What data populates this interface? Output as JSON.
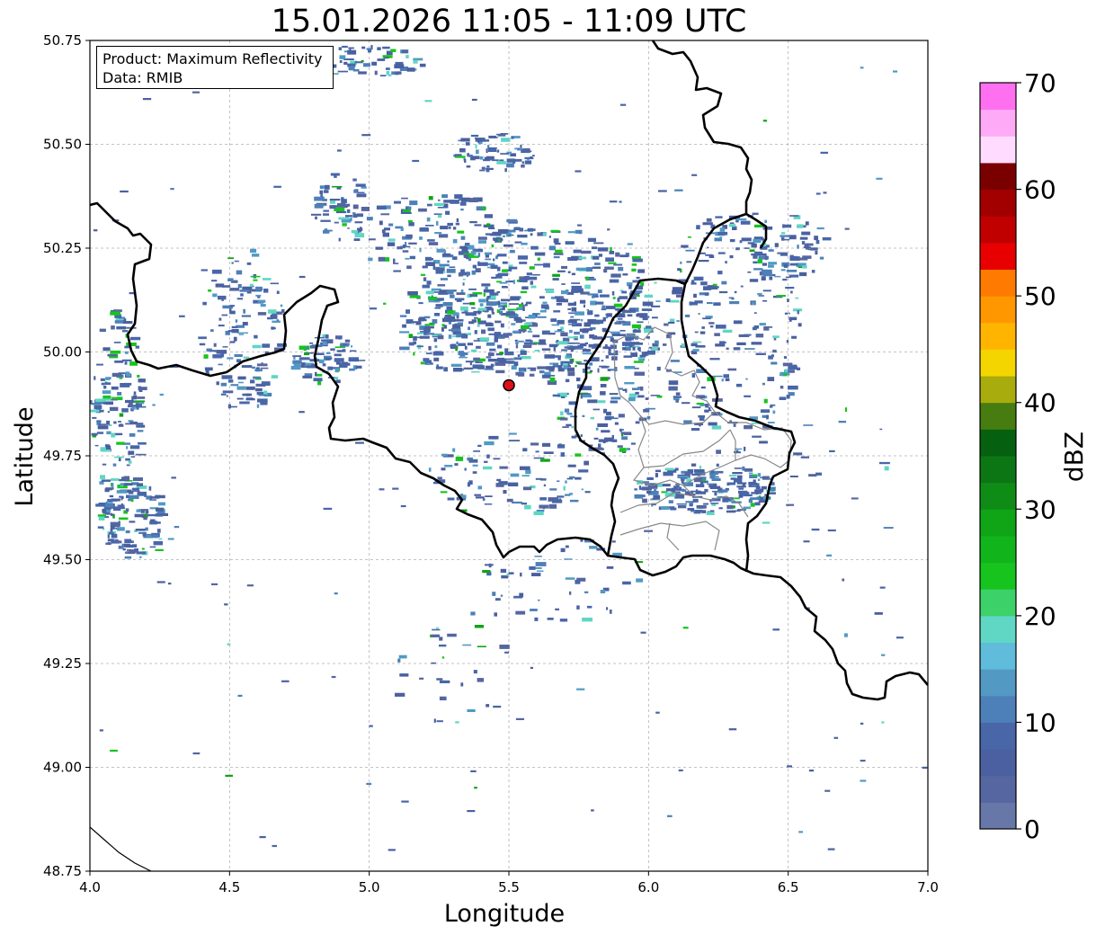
{
  "title": "15.01.2026 11:05 - 11:09 UTC",
  "legend": {
    "product": "Product: Maximum Reflectivity",
    "data": "Data: RMIB"
  },
  "axes": {
    "xlabel": "Longitude",
    "ylabel": "Latitude",
    "x_ticks": [
      "4.0",
      "4.5",
      "5.0",
      "5.5",
      "6.0",
      "6.5",
      "7.0"
    ],
    "y_ticks": [
      "50.75",
      "50.50",
      "50.25",
      "50.00",
      "49.75",
      "49.50",
      "49.25",
      "49.00",
      "48.75"
    ],
    "xlim": [
      4.0,
      7.0
    ],
    "ylim": [
      48.75,
      50.75
    ],
    "grid": true
  },
  "radar_site": {
    "lon": 5.5,
    "lat": 49.92,
    "color": "#e0101a"
  },
  "colorbar": {
    "label": "dBZ",
    "ticks": [
      "0",
      "10",
      "20",
      "30",
      "40",
      "50",
      "60",
      "70"
    ],
    "range": [
      0,
      70
    ],
    "step": 2.5,
    "colors": [
      "#6677a8",
      "#5566a0",
      "#4a60a0",
      "#4866a8",
      "#4d80b8",
      "#5299c4",
      "#5fbcdb",
      "#60d6c4",
      "#3dd16a",
      "#17c41e",
      "#12b41c",
      "#10a417",
      "#0e8c16",
      "#0d7614",
      "#056010",
      "#467c10",
      "#a8ac0c",
      "#f5d500",
      "#ffb500",
      "#ff9800",
      "#ff7a00",
      "#e80000",
      "#c00000",
      "#a20000",
      "#7a0000",
      "#ffdcff",
      "#ffaaf6",
      "#ff70f0",
      "#f032ee"
    ]
  },
  "colors": {
    "border": "#000000",
    "sub_border": "#888888",
    "grid": "#b0b0b0",
    "echo_main": "#4a64a4"
  }
}
